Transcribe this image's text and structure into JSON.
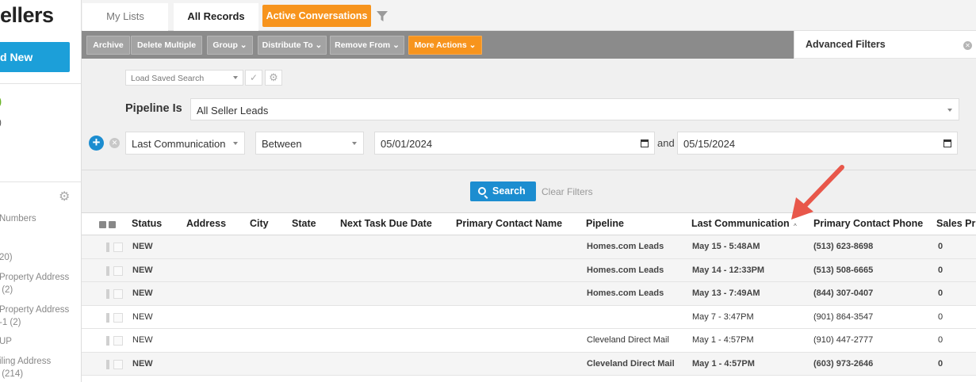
{
  "sidebar": {
    "title": "ellers",
    "add_new": "d New",
    "stats": [
      ")",
      ")"
    ],
    "items": [
      "Numbers",
      "20)",
      "Property Address\n (2)",
      "Property Address\n-1 (2)",
      "UP",
      "iling Address\n (214)"
    ]
  },
  "tabs": [
    {
      "label": "My Lists"
    },
    {
      "label": "All Records"
    },
    {
      "label": "Active Conversations"
    }
  ],
  "toolbar": {
    "buttons": [
      "Archive",
      "Delete Multiple",
      "Group",
      "Distribute To",
      "Remove From",
      "More Actions"
    ]
  },
  "advanced_filters": {
    "label": "Advanced Filters"
  },
  "filters": {
    "saved_search_placeholder": "Load Saved Search",
    "pipeline_label": "Pipeline Is",
    "pipeline_value": "All Seller Leads",
    "field": "Last Communication",
    "operator": "Between",
    "date_from": "05/01/2024",
    "and_label": "and",
    "date_to": "05/15/2024",
    "search_label": "Search",
    "clear_label": "Clear Filters"
  },
  "table": {
    "columns": [
      "Status",
      "Address",
      "City",
      "State",
      "Next Task Due Date",
      "Primary Contact Name",
      "Pipeline",
      "Last Communication",
      "Primary Contact Phone",
      "Sales Pr"
    ],
    "rows": [
      {
        "status": "NEW",
        "pipeline": "Homes.com Leads",
        "last_comm": "May 15 - 5:48AM",
        "phone": "(513) 623-8698",
        "sales": "0"
      },
      {
        "status": "NEW",
        "pipeline": "Homes.com Leads",
        "last_comm": "May 14 - 12:33PM",
        "phone": "(513) 508-6665",
        "sales": "0"
      },
      {
        "status": "NEW",
        "pipeline": "Homes.com Leads",
        "last_comm": "May 13 - 7:49AM",
        "phone": "(844) 307-0407",
        "sales": "0"
      },
      {
        "status": "NEW",
        "pipeline": "",
        "last_comm": "May 7 - 3:47PM",
        "phone": "(901) 864-3547",
        "sales": "0"
      },
      {
        "status": "NEW",
        "pipeline": "Cleveland Direct Mail",
        "last_comm": "May 1 - 4:57PM",
        "phone": "(910) 447-2777",
        "sales": "0"
      },
      {
        "status": "NEW",
        "pipeline": "Cleveland Direct Mail",
        "last_comm": "May 1 - 4:57PM",
        "phone": "(603) 973-2646",
        "sales": "0"
      }
    ]
  },
  "colors": {
    "accent_orange": "#f7941d",
    "accent_blue": "#1c8dd0",
    "annotation_arrow": "#e8574a"
  }
}
